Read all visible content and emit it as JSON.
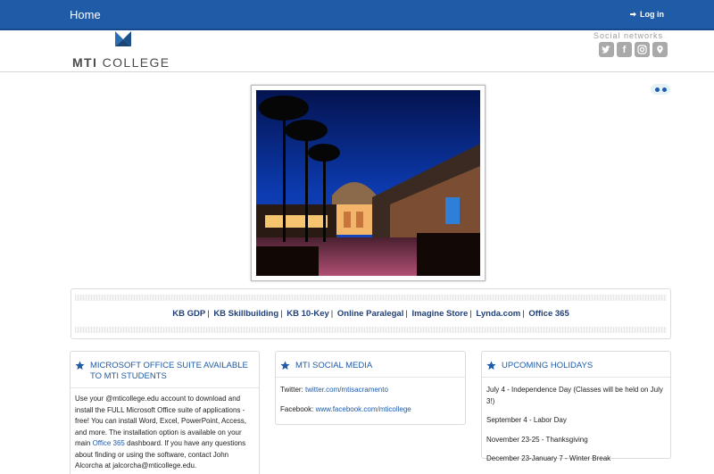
{
  "nav": {
    "home": "Home",
    "login": "Log in"
  },
  "brand": {
    "mti": "MTI",
    "college": " COLLEGE"
  },
  "social": {
    "title": "Social networks",
    "icons": [
      "twitter-icon",
      "facebook-icon",
      "instagram-icon",
      "location-icon"
    ]
  },
  "links": [
    "KB GDP",
    "KB Skillbuilding",
    "KB 10-Key",
    "Online Paralegal",
    "Imagine Store",
    "Lynda.com",
    "Office 365"
  ],
  "cards": {
    "office": {
      "title": "MICROSOFT OFFICE SUITE AVAILABLE TO MTI STUDENTS",
      "body_1": "Use your @mticollege.edu account to download and install the FULL Microsoft Office suite of applications - free! You can install Word, Excel, PowerPoint, Access, and more. The installation option is available on your main ",
      "body_link": "Office 365",
      "body_2": " dashboard. If you have any questions about finding or using the software, contact John Alcorcha at jalcorcha@mticollege.edu."
    },
    "social": {
      "title": "MTI SOCIAL MEDIA",
      "twitter_label": "Twitter: ",
      "twitter_link": "twitter.com/mtisacramento",
      "facebook_label": "Facebook: ",
      "facebook_link": "www.facebook.com/mticollege"
    },
    "holidays": {
      "title": "UPCOMING HOLIDAYS",
      "items": [
        "July 4 - Independence Day (Classes will be held on July 3!)",
        "September 4 - Labor Day",
        "November 23-25 - Thanksgiving",
        "December 23-January 7 - Winter Break"
      ]
    }
  },
  "colors": {
    "accent": "#1f5ba6",
    "link": "#1f3f77"
  }
}
